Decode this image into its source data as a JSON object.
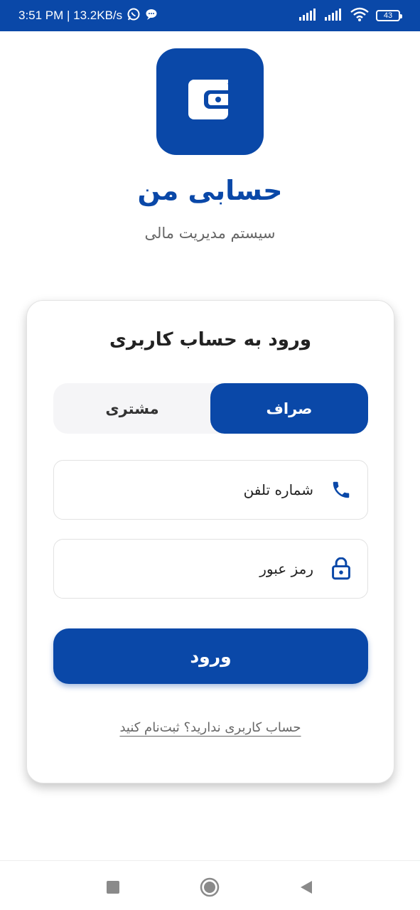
{
  "status_bar": {
    "time_speed": "3:51 PM | 13.2KB/s",
    "battery": "43"
  },
  "header": {
    "logo_icon": "wallet-icon",
    "title": "حسابی من",
    "subtitle": "سیستم مدیریت مالی"
  },
  "card": {
    "title": "ورود به حساب کاربری",
    "segments": {
      "active": "صراف",
      "inactive": "مشتری"
    },
    "phone_field": {
      "placeholder": "شماره تلفن",
      "icon": "phone-icon"
    },
    "password_field": {
      "placeholder": "رمز عبور",
      "icon": "lock-icon"
    },
    "submit_label": "ورود",
    "register_link": "حساب کاربری ندارید؟ ثبت‌نام کنید"
  },
  "colors": {
    "primary": "#0a48a8",
    "background": "#ffffff",
    "segment_bg": "#f5f5f7"
  }
}
